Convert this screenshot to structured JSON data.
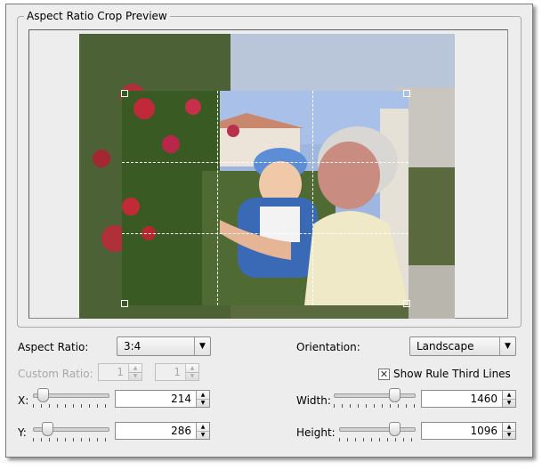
{
  "group": {
    "title": "Aspect Ratio Crop Preview"
  },
  "aspect_ratio": {
    "label": "Aspect Ratio:",
    "value": "3:4"
  },
  "orientation": {
    "label": "Orientation:",
    "value": "Landscape"
  },
  "custom_ratio": {
    "label": "Custom Ratio:",
    "numerator": "1",
    "denominator": "1",
    "enabled": false
  },
  "rule_third_lines": {
    "label": "Show Rule Third Lines",
    "checked": true
  },
  "x": {
    "label": "X:",
    "value": "214"
  },
  "y": {
    "label": "Y:",
    "value": "286"
  },
  "width": {
    "label": "Width:",
    "value": "1460"
  },
  "height": {
    "label": "Height:",
    "value": "1096"
  },
  "icons": {
    "dropdown": "chevron-down-icon",
    "spin_up": "arrow-up-icon",
    "spin_down": "arrow-down-icon",
    "check": "check-icon"
  },
  "colors": {
    "dialog_bg": "#ededed",
    "crop_shade": "#787878",
    "guide_lines": "#ffffff"
  }
}
